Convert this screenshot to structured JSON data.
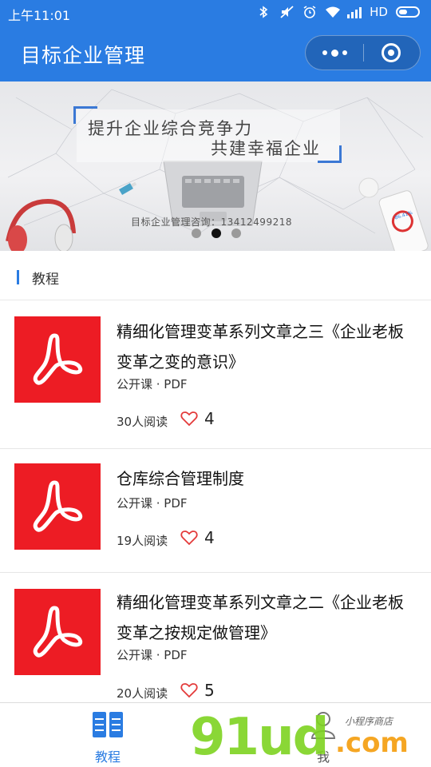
{
  "status_bar": {
    "time": "上午11:01",
    "network": "HD"
  },
  "navbar": {
    "title": "目标企业管理"
  },
  "banner": {
    "line1": "提升企业综合竞争力",
    "line2": "共建幸福企业",
    "contact": "目标企业管理咨询：13412499218",
    "slide_count": 3,
    "active_slide": 2
  },
  "section": {
    "title": "教程"
  },
  "articles": [
    {
      "title": "精细化管理变革系列文章之三《企业老板变革之变的意识》",
      "meta": "公开课 · PDF",
      "reads": "30人阅读",
      "likes": "4",
      "icon": "pdf-icon"
    },
    {
      "title": "仓库综合管理制度",
      "meta": "公开课 · PDF",
      "reads": "19人阅读",
      "likes": "4",
      "icon": "pdf-icon"
    },
    {
      "title": "精细化管理变革系列文章之二《企业老板变革之按规定做管理》",
      "meta": "公开课 · PDF",
      "reads": "20人阅读",
      "likes": "5",
      "icon": "pdf-icon"
    }
  ],
  "tabbar": {
    "tabs": [
      {
        "label": "教程",
        "icon": "book-icon",
        "active": true
      },
      {
        "label": "我",
        "icon": "person-icon",
        "active": false
      }
    ]
  },
  "watermark": {
    "brand": "91ud",
    "suffix": ".com",
    "tagline": "小程序商店"
  },
  "colors": {
    "primary": "#2a7ce2",
    "pdf_red": "#ed1c24",
    "heart": "#e33a3a"
  }
}
